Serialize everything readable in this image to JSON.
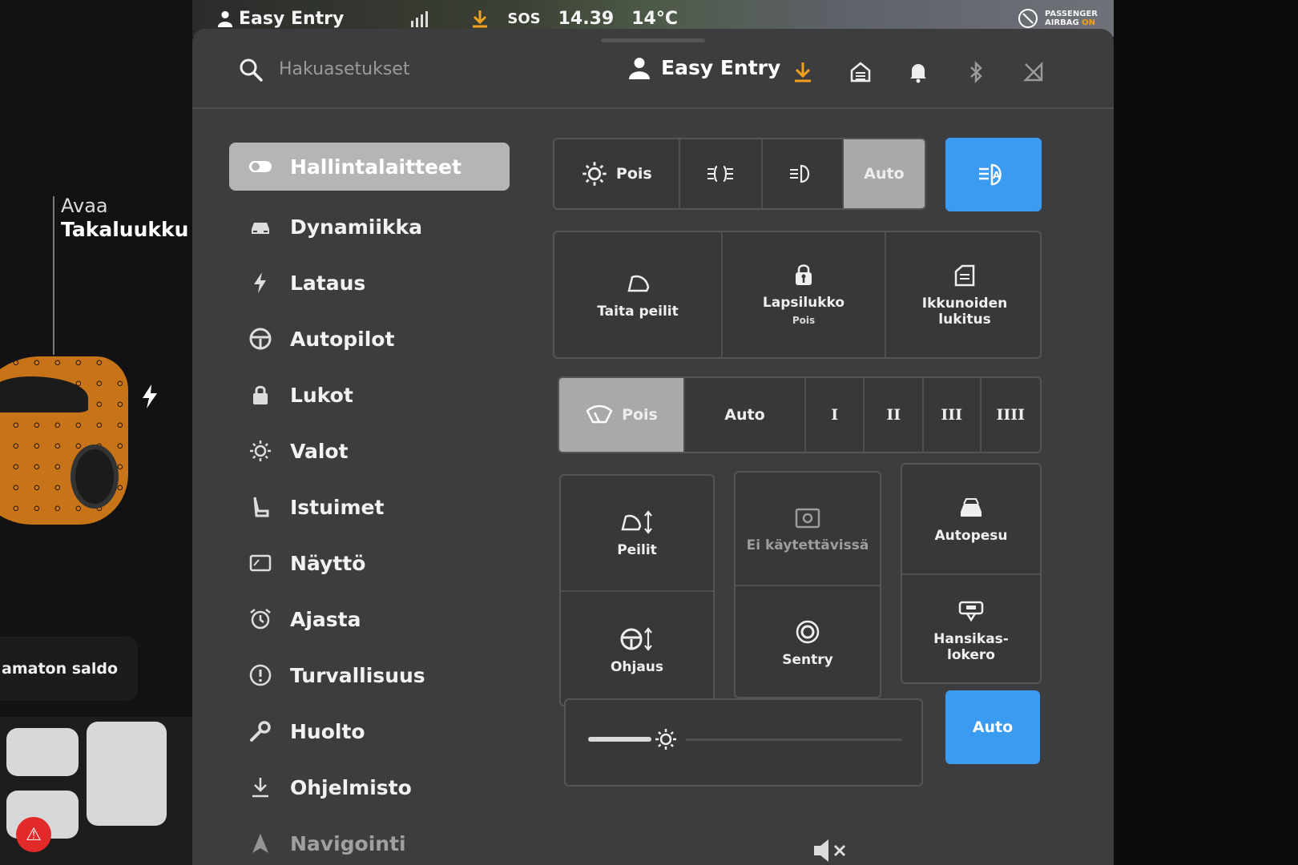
{
  "status_bar": {
    "profile": "Easy Entry",
    "sos": "SOS",
    "time": "14.39",
    "temperature": "14°C",
    "airbag_line1": "PASSENGER",
    "airbag_line2": "AIRBAG",
    "airbag_state": "ON"
  },
  "car_panel": {
    "open": "Avaa",
    "trunk": "Takaluukku",
    "balance": "amaton saldo"
  },
  "search": {
    "placeholder": "Hakuasetukset"
  },
  "profile": {
    "name": "Easy Entry"
  },
  "menu": {
    "items": [
      {
        "label": "Hallintalaitteet",
        "icon": "toggle-icon"
      },
      {
        "label": "Dynamiikka",
        "icon": "car-icon"
      },
      {
        "label": "Lataus",
        "icon": "bolt-icon"
      },
      {
        "label": "Autopilot",
        "icon": "steering-wheel-icon"
      },
      {
        "label": "Lukot",
        "icon": "lock-icon"
      },
      {
        "label": "Valot",
        "icon": "sun-icon"
      },
      {
        "label": "Istuimet",
        "icon": "seat-icon"
      },
      {
        "label": "Näyttö",
        "icon": "display-icon"
      },
      {
        "label": "Ajasta",
        "icon": "alarm-clock-icon"
      },
      {
        "label": "Turvallisuus",
        "icon": "alert-circle-icon"
      },
      {
        "label": "Huolto",
        "icon": "wrench-icon"
      },
      {
        "label": "Ohjelmisto",
        "icon": "download-icon"
      },
      {
        "label": "Navigointi",
        "icon": "navigation-icon"
      }
    ]
  },
  "lights": {
    "off_label": "Pois",
    "auto_label": "Auto",
    "selected": "Auto"
  },
  "tiles_row1": {
    "fold_mirrors": "Taita peilit",
    "child_lock": "Lapsilukko",
    "child_lock_state": "Pois",
    "window_lock_1": "Ikkunoiden",
    "window_lock_2": "lukitus"
  },
  "wipers": {
    "off_label": "Pois",
    "auto_label": "Auto",
    "speeds": [
      "I",
      "II",
      "III",
      "IIII"
    ],
    "selected": "Pois"
  },
  "tiles_row2": {
    "mirrors": "Peilit",
    "unavailable": "Ei käytettävissä",
    "car_wash": "Autopesu",
    "steering": "Ohjaus",
    "sentry": "Sentry",
    "glovebox_1": "Hansikas-",
    "glovebox_2": "lokero"
  },
  "brightness": {
    "level": 0.18,
    "auto_label": "Auto"
  },
  "colors": {
    "accent_blue": "#3a9bf0",
    "warning_orange": "#f3a01d",
    "panel_bg": "#3d3d3f"
  }
}
